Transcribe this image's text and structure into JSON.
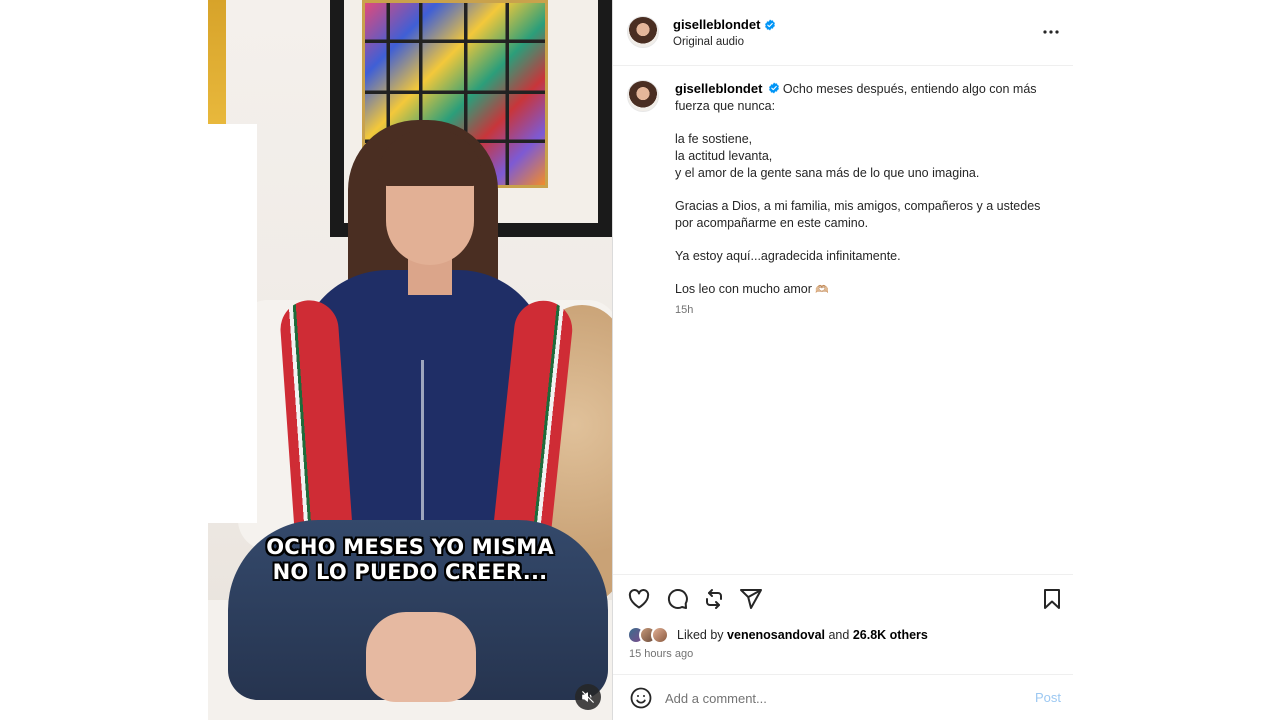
{
  "video": {
    "caption_lines": [
      "OCHO MESES YO MISMA",
      "NO LO PUEDO CREER..."
    ],
    "mute_icon": "speaker-muted-icon"
  },
  "header": {
    "username": "giselleblondet",
    "subtitle": "Original audio",
    "verified_icon": "verified-badge-icon",
    "more_icon": "more-horizontal-icon"
  },
  "post": {
    "username": "giselleblondet",
    "intro": "Ocho meses después, entiendo algo con más fuerza que nunca:",
    "line1": "la fe sostiene,",
    "line2": "la actitud levanta,",
    "line3": "y el amor de la gente sana más de lo que uno imagina.",
    "thanks": "Gracias a Dios, a mi familia, mis amigos, compañeros y a ustedes por acompañarme en este camino.",
    "here": "Ya estoy aquí...agradecida infinitamente.",
    "closing": "Los leo con mucho amor",
    "closing_emoji": "🫶🏼",
    "timestamp": "15h"
  },
  "actions": {
    "icons": [
      "heart-icon",
      "comment-icon",
      "repost-icon",
      "share-icon",
      "bookmark-icon"
    ],
    "liked_by_prefix": "Liked by",
    "liked_by_user": "venenosandoval",
    "liked_by_and": "and",
    "liked_by_others": "26.8K others",
    "time_ago": "15 hours ago"
  },
  "comment": {
    "placeholder": "Add a comment...",
    "post_label": "Post",
    "emoji_icon": "emoji-smile-icon"
  },
  "colors": {
    "verified": "#0095f6",
    "post_button": "#9cc8f2",
    "muted_text": "#737373"
  }
}
